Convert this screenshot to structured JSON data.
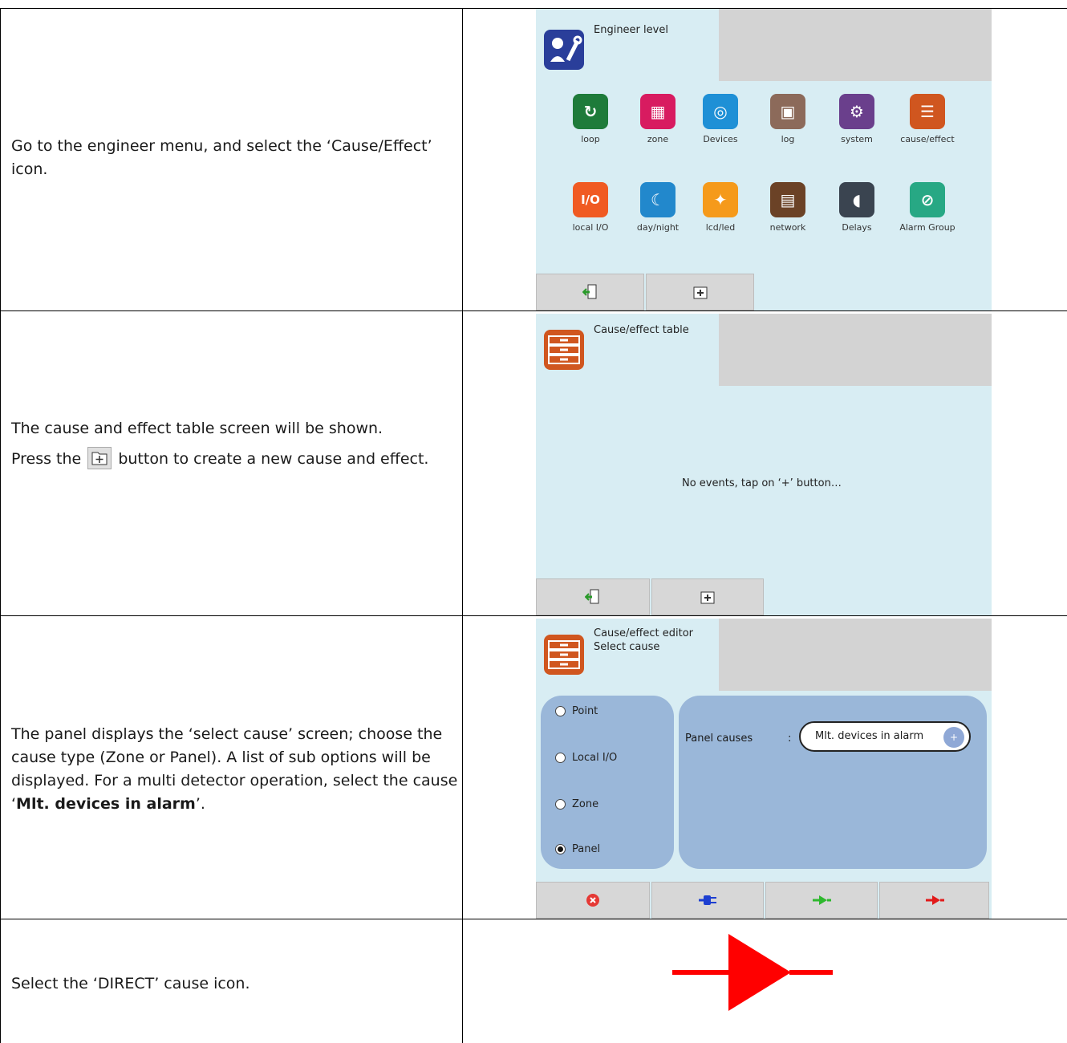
{
  "rows": [
    {
      "text": [
        "Go to the engineer menu, and select the ‘Cause/Effect’ icon."
      ],
      "screen": {
        "title": "Engineer level",
        "icons": [
          {
            "label": "loop",
            "color": "#1e7b3a"
          },
          {
            "label": "zone",
            "color": "#d81b60"
          },
          {
            "label": "Devices",
            "color": "#1e90d6"
          },
          {
            "label": "log",
            "color": "#8c6a5a"
          },
          {
            "label": "system",
            "color": "#6a3f8c"
          },
          {
            "label": "cause/effect",
            "color": "#d0561f"
          },
          {
            "label": "local I/O",
            "color": "#f05a22"
          },
          {
            "label": "day/night",
            "color": "#2288cc"
          },
          {
            "label": "lcd/led",
            "color": "#f59a1b"
          },
          {
            "label": "network",
            "color": "#6b4226"
          },
          {
            "label": "Delays",
            "color": "#3a4450"
          },
          {
            "label": "Alarm Group",
            "color": "#27a884"
          }
        ]
      }
    },
    {
      "text_lines": [
        "The cause and effect table screen will be shown.",
        "Press the",
        "button to create a new cause and effect."
      ],
      "screen": {
        "title": "Cause/effect table",
        "message": "No events, tap on ‘+’ button…"
      }
    },
    {
      "text_pre": "The panel displays the ‘select cause’ screen; choose the cause type (Zone or Panel). A list of sub options will be displayed. For a multi detector operation, select the cause ‘",
      "text_bold": "Mlt. devices in alarm",
      "text_post": "’.",
      "screen": {
        "title_line1": "Cause/effect editor",
        "title_line2": "Select cause",
        "options": [
          "Point",
          "Local I/O",
          "Zone",
          "Panel"
        ],
        "selected": "Panel",
        "panel_causes_label": "Panel causes",
        "separator": ":",
        "panel_causes_value": "Mlt. devices in alarm"
      }
    },
    {
      "text": "Select the ‘DIRECT’ cause icon."
    }
  ]
}
